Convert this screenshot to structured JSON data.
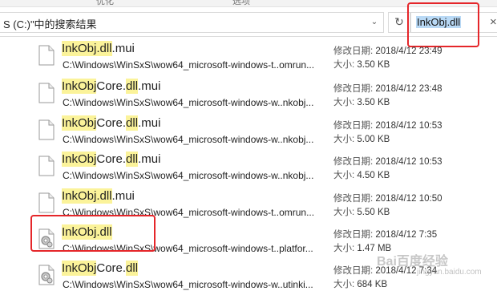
{
  "ribbon": {
    "label_left": "优化",
    "label_right": "选项"
  },
  "address": {
    "text": "S (C:)\"中的搜索结果"
  },
  "search": {
    "value": "InkObj.dll"
  },
  "labels": {
    "modified": "修改日期: ",
    "size": "大小: "
  },
  "files": [
    {
      "name_hl": "InkObj.dll",
      "name_rest": ".mui",
      "name_hl2": "",
      "name_rest2": "",
      "path": "C:\\Windows\\WinSxS\\wow64_microsoft-windows-t..omrun...",
      "modified": "2018/4/12 23:49",
      "size": "3.50 KB",
      "icon": "document-icon"
    },
    {
      "name_hl": "InkObj",
      "name_rest": "Core.",
      "name_hl2": "dll",
      "name_rest2": ".mui",
      "path": "C:\\Windows\\WinSxS\\wow64_microsoft-windows-w..nkobj...",
      "modified": "2018/4/12 23:48",
      "size": "3.50 KB",
      "icon": "document-icon"
    },
    {
      "name_hl": "InkObj",
      "name_rest": "Core.",
      "name_hl2": "dll",
      "name_rest2": ".mui",
      "path": "C:\\Windows\\WinSxS\\wow64_microsoft-windows-w..nkobj...",
      "modified": "2018/4/12 10:53",
      "size": "5.00 KB",
      "icon": "document-icon"
    },
    {
      "name_hl": "InkObj",
      "name_rest": "Core.",
      "name_hl2": "dll",
      "name_rest2": ".mui",
      "path": "C:\\Windows\\WinSxS\\wow64_microsoft-windows-w..nkobj...",
      "modified": "2018/4/12 10:53",
      "size": "4.50 KB",
      "icon": "document-icon"
    },
    {
      "name_hl": "InkObj.dll",
      "name_rest": ".mui",
      "name_hl2": "",
      "name_rest2": "",
      "path": "C:\\Windows\\WinSxS\\wow64_microsoft-windows-t..omrun...",
      "modified": "2018/4/12 10:50",
      "size": "5.50 KB",
      "icon": "document-icon"
    },
    {
      "name_hl": "InkObj.dll",
      "name_rest": "",
      "name_hl2": "",
      "name_rest2": "",
      "path": "C:\\Windows\\WinSxS\\wow64_microsoft-windows-t..platfor...",
      "modified": "2018/4/12 7:35",
      "size": "1.47 MB",
      "icon": "dll-gear-icon"
    },
    {
      "name_hl": "InkObj",
      "name_rest": "Core.",
      "name_hl2": "dll",
      "name_rest2": "",
      "path": "C:\\Windows\\WinSxS\\wow64_microsoft-windows-w..utinki...",
      "modified": "2018/4/12 7:34",
      "size": "684 KB",
      "icon": "dll-gear-icon"
    }
  ],
  "colors": {
    "highlight": "#fbf39a",
    "selection": "#b9d9f5",
    "annotation": "#e5262a"
  },
  "watermark": {
    "text": "Bai百度经验",
    "sub": "jingyan.baidu.com"
  }
}
